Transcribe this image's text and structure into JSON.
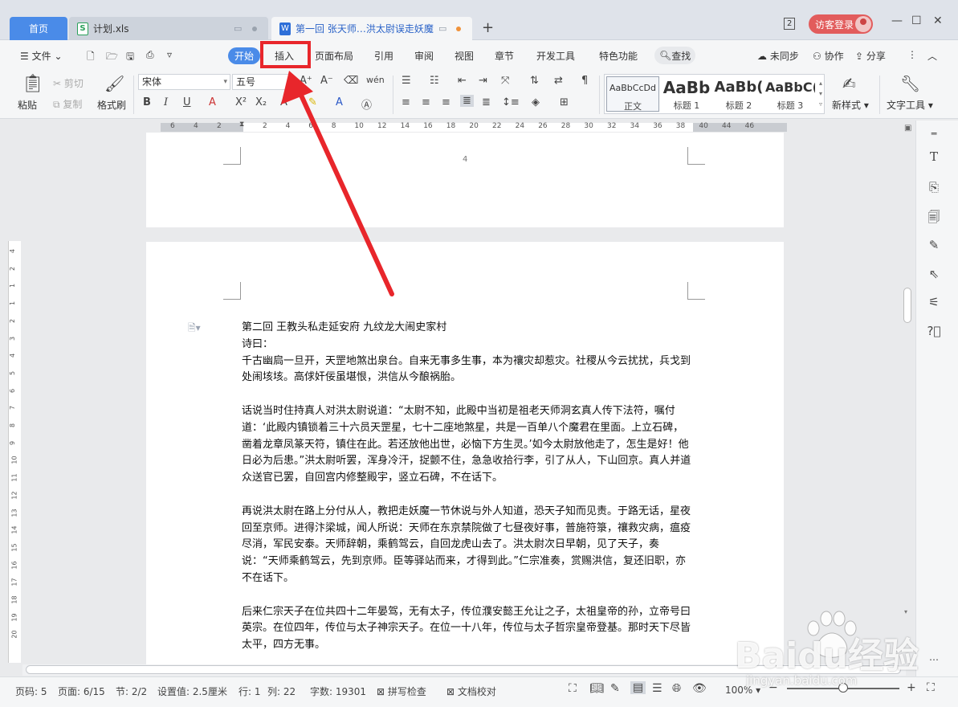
{
  "titlebar": {
    "tabs": [
      {
        "label": "首页"
      },
      {
        "label": "计划.xls",
        "icon": "S"
      },
      {
        "label": "第一回 张天师…洪太尉误走妖魔",
        "icon": "W"
      }
    ],
    "notification_count": "2",
    "login_label": "访客登录"
  },
  "menubar": {
    "file_label": "文件",
    "tabs": [
      "开始",
      "插入",
      "页面布局",
      "引用",
      "审阅",
      "视图",
      "章节",
      "开发工具",
      "特色功能"
    ],
    "search_label": "查找",
    "sync_label": "未同步",
    "collab_label": "协作",
    "share_label": "分享"
  },
  "ribbon": {
    "paste": "粘贴",
    "cut": "剪切",
    "copy": "复制",
    "format_painter": "格式刷",
    "font_name": "宋体",
    "font_size": "五号",
    "styles": [
      {
        "sample": "AaBbCcDd",
        "name": "正文"
      },
      {
        "sample": "AaBb",
        "name": "标题 1"
      },
      {
        "sample": "AaBb(",
        "name": "标题 2"
      },
      {
        "sample": "AaBbC(",
        "name": "标题 3"
      }
    ],
    "new_style": "新样式",
    "text_tools": "文字工具"
  },
  "ruler": {
    "ticks_left": [
      "6",
      "4",
      "2"
    ],
    "ticks_right": [
      "2",
      "4",
      "6",
      "8",
      "10",
      "12",
      "14",
      "16",
      "18",
      "20",
      "22",
      "24",
      "26",
      "28",
      "30",
      "32",
      "34",
      "36",
      "38",
      "40",
      "44",
      "46"
    ],
    "vticks": [
      "4",
      "2",
      "1",
      "1",
      "2",
      "3",
      "4",
      "5",
      "6",
      "7",
      "8",
      "9",
      "10",
      "11",
      "12",
      "13",
      "14",
      "15",
      "16",
      "17",
      "18",
      "19",
      "20"
    ]
  },
  "document": {
    "prev_page_number": "4",
    "title": "第二回 王教头私走延安府 九纹龙大闹史家村",
    "paragraphs": [
      "诗曰：",
      "千古幽扃一旦开，天罡地煞出泉台。自来无事多生事，本为禳灾却惹灾。社稷从今云扰扰，兵戈到处闹垓垓。高俅奸佞虽堪恨，洪信从今酿祸胎。",
      "",
      "话说当时住持真人对洪太尉说道：“太尉不知，此殿中当初是祖老天师洞玄真人传下法符，嘱付道：‘此殿内镇锁着三十六员天罡星，七十二座地煞星，共是一百单八个魔君在里面。上立石碑，凿着龙章凤篆天符，镇住在此。若还放他出世，必恼下方生灵。’如今太尉放他走了，怎生是好！他日必为后患。”洪太尉听罢，浑身冷汗，捉颤不住，急急收拾行李，引了从人，下山回京。真人并道众送官已罢，自回宫内修整殿宇，竖立石碑，不在话下。",
      "",
      "再说洪太尉在路上分付从人，教把走妖魔一节休说与外人知道，恐天子知而见责。于路无话，星夜回至京师。进得汴梁城，闻人所说：天师在东京禁院做了七昼夜好事，普施符箓，禳救灾病，瘟疫尽消，军民安泰。天师辞朝，乘鹤驾云，自回龙虎山去了。洪太尉次日早朝，见了天子，奏说：“天师乘鹤驾云，先到京师。臣等驿站而来，才得到此。”仁宗准奏，赏赐洪信，复还旧职，亦不在话下。",
      "",
      "后来仁宗天子在位共四十二年晏驾，无有太子，传位濮安懿王允让之子，太祖皇帝的孙，立帝号曰英宗。在位四年，传位与太子神宗天子。在位一十八年，传位与太子哲宗皇帝登基。那时天下尽皆太平，四方无事。"
    ]
  },
  "statusbar": {
    "page_code": "页码: 5",
    "page": "页面: 6/15",
    "section": "节: 2/2",
    "setting": "设置值: 2.5厘米",
    "row": "行: 1",
    "col": "列: 22",
    "words": "字数: 19301",
    "spell_check": "拼写检查",
    "doc_proof": "文档校对",
    "zoom": "100%",
    "zoom_value": 0.5
  },
  "watermark": {
    "brand": "Baidu经验",
    "url": "jingyan.baidu.com"
  },
  "colors": {
    "accent": "#4a8be8",
    "highlight_box": "#e8262b",
    "login": "#e25c5c"
  }
}
